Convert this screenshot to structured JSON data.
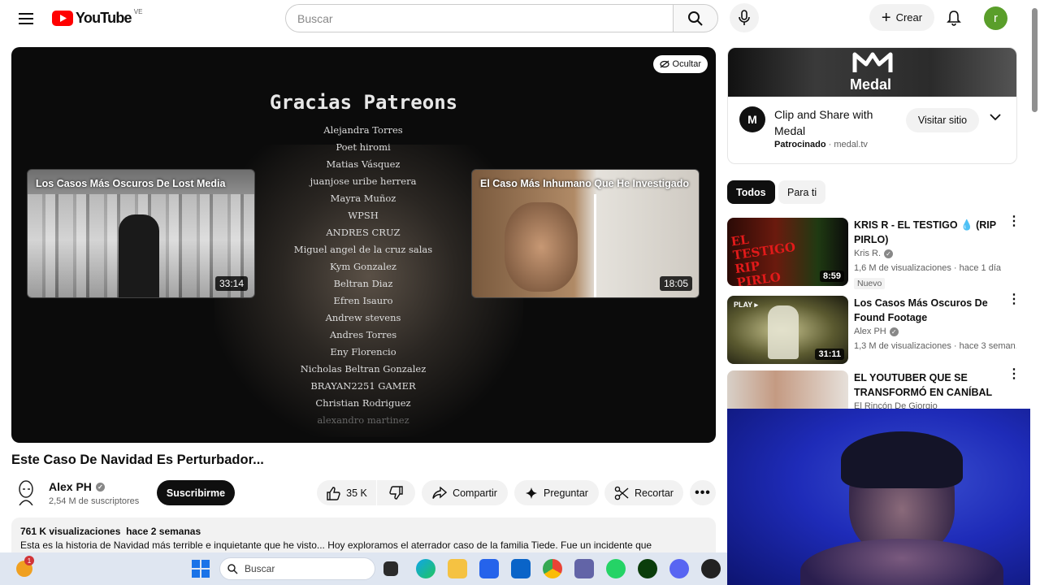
{
  "header": {
    "logo_text": "YouTube",
    "region": "VE",
    "search_placeholder": "Buscar",
    "create_label": "Crear",
    "avatar_letter": "r"
  },
  "player": {
    "hide_label": "Ocultar",
    "credits_title": "Gracias Patreons",
    "credits": [
      "Alejandra Torres",
      "Poet hiromi",
      "Matias Vásquez",
      "juanjose uribe herrera",
      "Mayra Muñoz",
      "WPSH",
      "ANDRES CRUZ",
      "Miguel angel de la cruz salas",
      "Kym Gonzalez",
      "Beltran Diaz",
      "Efren Isauro",
      "Andrew stevens",
      "Andres Torres",
      "Eny Florencio",
      "Nicholas Beltran Gonzalez",
      "BRAYAN2251 GAMER",
      "Christian Rodriguez",
      "alexandro martinez"
    ],
    "endcards": [
      {
        "title": "Los Casos Más Oscuros De Lost Media",
        "duration": "33:14"
      },
      {
        "title": "El Caso Más Inhumano Que He Investigado",
        "duration": "18:05"
      }
    ]
  },
  "video": {
    "title": "Este Caso De Navidad Es Perturbador...",
    "channel": "Alex PH",
    "subscribers": "2,54 M de suscriptores",
    "subscribe_label": "Suscribirme",
    "likes": "35 K",
    "share_label": "Compartir",
    "ask_label": "Preguntar",
    "clip_label": "Recortar",
    "views": "761 K visualizaciones",
    "date": "hace 2 semanas",
    "description": "Esta es la historia de Navidad más terrible e inquietante que he visto... Hoy exploramos el aterrador caso de la familia Tiede. Fue un incidente que"
  },
  "ad": {
    "logo_text": "Medal",
    "title": "Clip and Share with Medal",
    "sponsored": "Patrocinado",
    "domain": "medal.tv",
    "visit_label": "Visitar sitio"
  },
  "chips": [
    "Todos",
    "Para ti"
  ],
  "recommendations": [
    {
      "title": "KRIS R - EL TESTIGO 💧 (RIP PIRLO)",
      "channel": "Kris R.",
      "meta": "1,6 M de visualizaciones · hace 1 día",
      "badge": "Nuevo",
      "duration": "8:59",
      "thumb_text": "EL TESTIGO RIP PIRLO"
    },
    {
      "title": "Los Casos Más Oscuros De Found Footage",
      "channel": "Alex PH",
      "meta": "1,3 M de visualizaciones · hace 3 seman...",
      "badge": "",
      "duration": "31:11",
      "thumb_text": "PLAY ▸"
    },
    {
      "title": "EL YOUTUBER QUE SE TRANSFORMÓ EN CANÍBAL ...",
      "channel": "El Rincón De Giorgio",
      "meta": "",
      "badge": "",
      "duration": "",
      "thumb_text": ""
    }
  ],
  "taskbar": {
    "search_placeholder": "Buscar",
    "notif_count": "1"
  },
  "colors": {
    "brand_red": "#ff0000",
    "avatar_green": "#5a9e2a",
    "webcam_blue": "#1e2bb8"
  }
}
